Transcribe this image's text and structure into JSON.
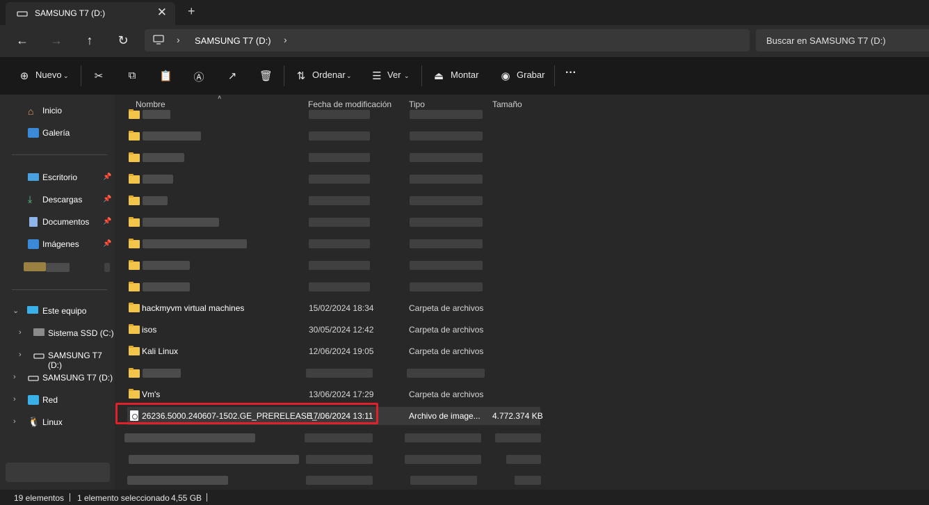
{
  "window": {
    "tab_title": "SAMSUNG T7 (D:)",
    "tab_close": "✕",
    "new_tab": "+"
  },
  "address": {
    "breadcrumb": [
      "SAMSUNG T7 (D:)"
    ],
    "separator": "›",
    "search_placeholder": "Buscar en SAMSUNG T7 (D:)"
  },
  "toolbar": {
    "new_label": "Nuevo",
    "sort_label": "Ordenar",
    "view_label": "Ver",
    "mount_label": "Montar",
    "burn_label": "Grabar",
    "more": "···"
  },
  "sidebar": {
    "top": [
      {
        "label": "Inicio",
        "icon": "home-icon"
      },
      {
        "label": "Galería",
        "icon": "gallery-icon"
      }
    ],
    "pinned": [
      {
        "label": "Escritorio",
        "icon": "desktop-icon"
      },
      {
        "label": "Descargas",
        "icon": "download-icon"
      },
      {
        "label": "Documentos",
        "icon": "documents-icon"
      },
      {
        "label": "Imágenes",
        "icon": "pictures-icon"
      }
    ],
    "this_pc": "Este equipo",
    "drives": [
      {
        "label": "Sistema SSD (C:)"
      },
      {
        "label": "SAMSUNG T7 (D:)"
      }
    ],
    "selected_drive": "SAMSUNG T7 (D:)",
    "network": "Red",
    "linux": "Linux"
  },
  "columns": {
    "name": "Nombre",
    "date": "Fecha de modificación",
    "type": "Tipo",
    "size": "Tamaño"
  },
  "files": [
    {
      "name": "hackmyvm virtual machines",
      "date": "15/02/2024 18:34",
      "type": "Carpeta de archivos",
      "size": ""
    },
    {
      "name": "isos",
      "date": "30/05/2024 12:42",
      "type": "Carpeta de archivos",
      "size": ""
    },
    {
      "name": "Kali Linux",
      "date": "12/06/2024 19:05",
      "type": "Carpeta de archivos",
      "size": ""
    },
    {
      "name": "Vm's",
      "date": "13/06/2024 17:29",
      "type": "Carpeta de archivos",
      "size": ""
    },
    {
      "name": "26236.5000.240607-1502.GE_PRERELEASE_...",
      "date": "17/06/2024 13:11",
      "type": "Archivo de image...",
      "size": "4.772.374 KB"
    }
  ],
  "status": {
    "count": "19 elementos",
    "selected": "1 elemento seleccionado",
    "size": "4,55 GB"
  },
  "colors": {
    "folder": "#f3c44a",
    "highlight": "#e0202a",
    "background": "#282828"
  }
}
